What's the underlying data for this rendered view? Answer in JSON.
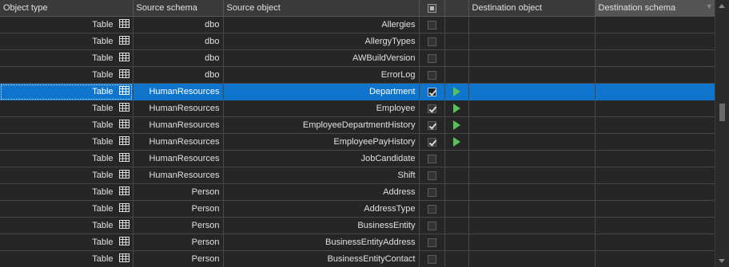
{
  "columns": {
    "object_type": "Object type",
    "source_schema": "Source schema",
    "source_object": "Source object",
    "destination_object": "Destination object",
    "destination_schema": "Destination schema"
  },
  "rows": [
    {
      "type": "Table",
      "schema": "dbo",
      "object": "Allergies",
      "checked": false,
      "run": false,
      "selected": false
    },
    {
      "type": "Table",
      "schema": "dbo",
      "object": "AllergyTypes",
      "checked": false,
      "run": false,
      "selected": false
    },
    {
      "type": "Table",
      "schema": "dbo",
      "object": "AWBuildVersion",
      "checked": false,
      "run": false,
      "selected": false
    },
    {
      "type": "Table",
      "schema": "dbo",
      "object": "ErrorLog",
      "checked": false,
      "run": false,
      "selected": false
    },
    {
      "type": "Table",
      "schema": "HumanResources",
      "object": "Department",
      "checked": true,
      "run": true,
      "selected": true
    },
    {
      "type": "Table",
      "schema": "HumanResources",
      "object": "Employee",
      "checked": true,
      "run": true,
      "selected": false
    },
    {
      "type": "Table",
      "schema": "HumanResources",
      "object": "EmployeeDepartmentHistory",
      "checked": true,
      "run": true,
      "selected": false
    },
    {
      "type": "Table",
      "schema": "HumanResources",
      "object": "EmployeePayHistory",
      "checked": true,
      "run": true,
      "selected": false
    },
    {
      "type": "Table",
      "schema": "HumanResources",
      "object": "JobCandidate",
      "checked": false,
      "run": false,
      "selected": false
    },
    {
      "type": "Table",
      "schema": "HumanResources",
      "object": "Shift",
      "checked": false,
      "run": false,
      "selected": false
    },
    {
      "type": "Table",
      "schema": "Person",
      "object": "Address",
      "checked": false,
      "run": false,
      "selected": false
    },
    {
      "type": "Table",
      "schema": "Person",
      "object": "AddressType",
      "checked": false,
      "run": false,
      "selected": false
    },
    {
      "type": "Table",
      "schema": "Person",
      "object": "BusinessEntity",
      "checked": false,
      "run": false,
      "selected": false
    },
    {
      "type": "Table",
      "schema": "Person",
      "object": "BusinessEntityAddress",
      "checked": false,
      "run": false,
      "selected": false
    },
    {
      "type": "Table",
      "schema": "Person",
      "object": "BusinessEntityContact",
      "checked": false,
      "run": false,
      "selected": false
    }
  ],
  "colors": {
    "selection": "#0f74cc",
    "run_arrow": "#57c157",
    "background": "#262626"
  },
  "icons": {
    "type_icon": "table-grid-icon",
    "run_icon": "play-arrow-icon",
    "filter_icon": "filter-icon"
  }
}
